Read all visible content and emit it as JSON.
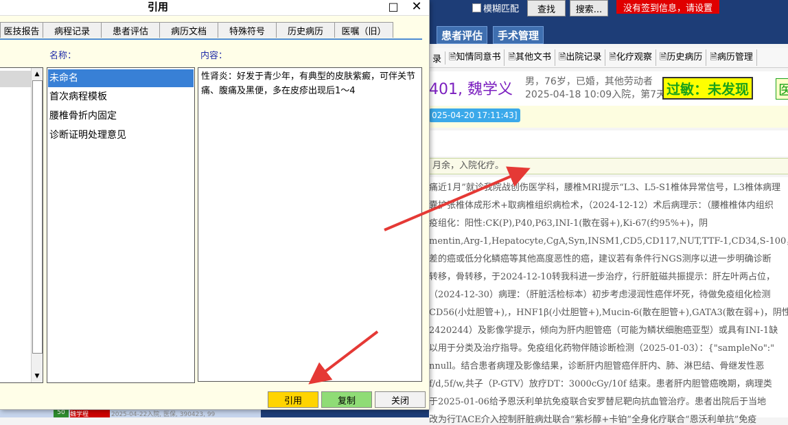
{
  "bg": {
    "fuzzy_label": "模糊匹配",
    "find_btn": "查找",
    "search_btn": "搜索...",
    "warning": "没有签到信息，请设置",
    "nav_tabs": [
      "患者评估",
      "手术管理"
    ],
    "subnav": [
      "录",
      "知情同意书",
      "其他文书",
      "出院记录",
      "化疗观察",
      "历史病历",
      "病历管理"
    ],
    "patient_name": "401, 魏学义",
    "patient_info1": "男，76岁，已婚，其他劳动者",
    "patient_info2": "2025-04-18 10:09入院，第7天",
    "allergy": "过敏：未发现",
    "allergy2": "医",
    "timestamp": "025-04-20 17:11:43]",
    "admit_text": "月余，入院化疗。",
    "doc_lines": [
      "痛近1月”就诊我院战创伤医学科，腰椎MRI提示“L3、L5-S1椎体异常信号，L3椎体病理",
      "囊扩张椎体成形术+取病椎组织病检术，（2024-12-12）术后病理示：（腰椎椎体内组织",
      "疫组化：阳性:CK(P),P40,P63,INI-1(散在弱+),Ki-67(约95%+)，阴",
      "mentin,Arg-1,Hepatocyte,CgA,Syn,INSM1,CD5,CD117,NUT,TTF-1,CD34,S-100，\\n（腰",
      "差的癌或低分化鳞癌等其他高度恶性的癌，建议若有条件行NGS测序以进一步明确诊断",
      "转移，骨转移，于2024-12-10转我科进一步治疗，行肝脏磁共振提示：肝左叶两占位，",
      "（2024-12-30）病理：（肝脏活检标本）初步考虑浸润性癌伴坏死，待做免疫组化检测",
      "CD56(小灶胆管+),，HNF1β(小灶胆管+),Mucin-6(散在胆管+),GATA3(散在弱+)，阴性",
      "2420244）及影像学提示，倾向为肝内胆管癌（可能为鳞状细胞癌亚型）或具有INI-1缺",
      "以用于分类及治疗指导。免疫组化药物伴随诊断检测（2025-01-03）：{\"sampleNo\":\"",
      "nnull。结合患者病理及影像结果，诊断肝内胆管癌伴肝内、肺、淋巴结、骨继发性恶",
      "f/d,5f/w,共子（P-GTV）放疗DT：3000cGy/10f 结束。患者肝内胆管癌晚期，病理类",
      "于2025-01-06给予恩沃利单抗免疫联合安罗替尼靶向抗血管治疗。患者出院后于当地",
      "改为行TACE介入控制肝脏病灶联合“紫杉醇+卡铂”全身化疗联合“恩沃利单抗”免疫"
    ],
    "bottom_left1": "50",
    "bottom_left2": "魏学程",
    "bottom_left3": "2025-04-22入院, 医保, 390423, 99"
  },
  "dialog": {
    "title": "引用",
    "max_icon": "□",
    "close_icon": "✕",
    "tabs": [
      "医技报告",
      "病程记录",
      "患者评估",
      "病历文档",
      "特殊符号",
      "历史病历",
      "医嘱（旧）"
    ],
    "name_label": "名称：",
    "content_label": "内容：",
    "items": [
      "未命名",
      "首次病程模板",
      "腰椎骨折内固定",
      "诊断证明处理意见"
    ],
    "content_text": "性肾炎：好发于青少年，有典型的皮肤紫癜，可伴关节痛、腹痛及黑便，多在皮疹出现后1～4",
    "btn_ref": "引用",
    "btn_copy": "复制",
    "btn_close": "关闭"
  },
  "colors": {
    "accent": "#3880d6",
    "ref_btn": "#ffd400",
    "copy_btn": "#8fdc76",
    "arrow": "#e53935"
  }
}
